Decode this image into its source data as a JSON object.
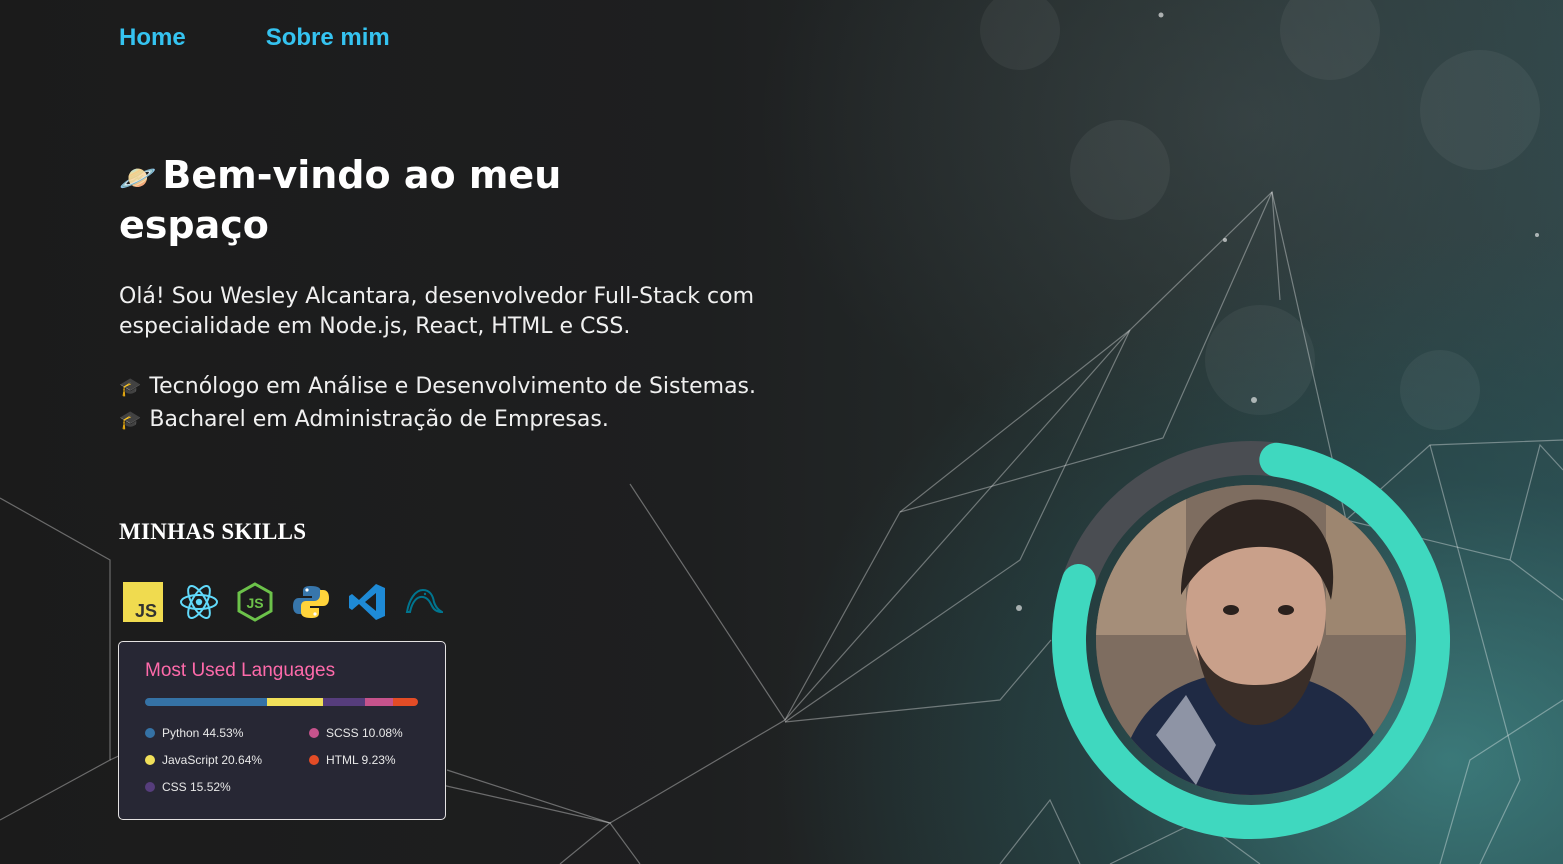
{
  "nav": {
    "home": "Home",
    "about": "Sobre mim"
  },
  "hero": {
    "icon": "🪐",
    "title": "Bem-vindo ao meu espaço",
    "intro": "Olá! Sou Wesley Alcantara, desenvolvedor Full-Stack com especialidade em Node.js, React, HTML e CSS.",
    "degree_icon": "🎓",
    "degree_1": "Tecnólogo em Análise e Desenvolvimento de Sistemas.",
    "degree_2": "Bacharel em Administração de Empresas."
  },
  "skills": {
    "title": "MINHAS SKILLS",
    "icons": [
      "javascript-icon",
      "react-icon",
      "nodejs-icon",
      "python-icon",
      "vscode-icon",
      "mysql-icon"
    ]
  },
  "languages_card": {
    "title": "Most Used Languages",
    "items": [
      {
        "label": "Python 44.53%",
        "name": "Python",
        "percent": 44.53,
        "color": "#3572A5"
      },
      {
        "label": "JavaScript 20.64%",
        "name": "JavaScript",
        "percent": 20.64,
        "color": "#f1e05a"
      },
      {
        "label": "CSS 15.52%",
        "name": "CSS",
        "percent": 15.52,
        "color": "#563d7c"
      },
      {
        "label": "SCSS 10.08%",
        "name": "SCSS",
        "percent": 10.08,
        "color": "#c6538c"
      },
      {
        "label": "HTML 9.23%",
        "name": "HTML",
        "percent": 9.23,
        "color": "#e34c26"
      }
    ]
  },
  "profile": {
    "ring_color": "#3fd8bf",
    "ring_track_color": "#4a4d52",
    "ring_progress": 0.78
  }
}
